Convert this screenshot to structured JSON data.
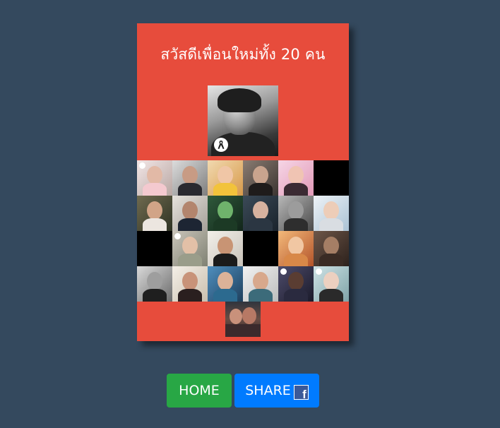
{
  "card": {
    "title": "สวัสดีเพื่อนใหม่ทั้ง 20 คน",
    "background_color": "#e74c3c",
    "main_photo_icon": "black-ribbon-icon",
    "friends_grid": [
      {
        "row": 1,
        "tiles": [
          "friend-photo",
          "friend-photo",
          "friend-photo",
          "friend-photo",
          "friend-photo",
          "empty-tile"
        ]
      },
      {
        "row": 2,
        "tiles": [
          "friend-photo",
          "friend-photo",
          "friend-photo",
          "friend-photo",
          "friend-photo",
          "friend-photo"
        ]
      },
      {
        "row": 3,
        "tiles": [
          "empty-tile",
          "friend-photo",
          "friend-photo",
          "empty-tile",
          "friend-photo",
          "friend-photo"
        ]
      },
      {
        "row": 4,
        "tiles": [
          "friend-photo",
          "friend-photo",
          "friend-photo",
          "friend-photo",
          "friend-photo",
          "friend-photo"
        ]
      }
    ]
  },
  "actions": {
    "home_label": "HOME",
    "share_label": "SHARE",
    "share_icon": "facebook-icon",
    "home_color": "#28a745",
    "share_color": "#007bff"
  },
  "colors": {
    "page_background": "#34495e"
  }
}
